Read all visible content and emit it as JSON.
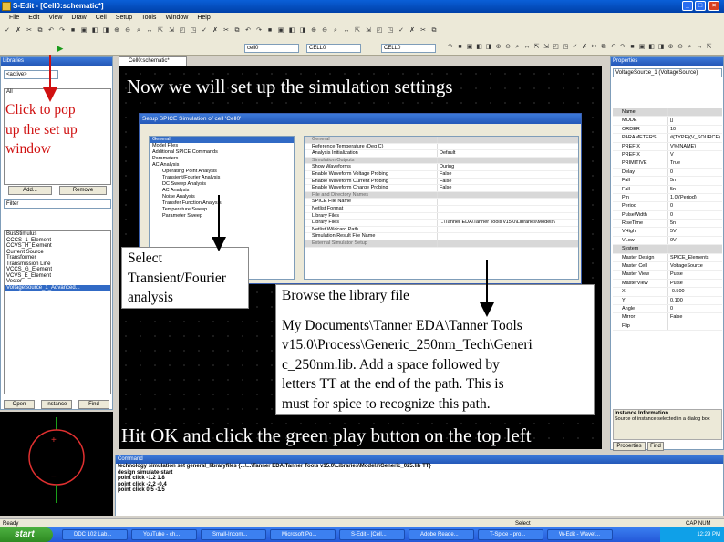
{
  "window": {
    "title": "S-Edit - [Cell0:schematic*]"
  },
  "menu": [
    "File",
    "Edit",
    "View",
    "Draw",
    "Cell",
    "Setup",
    "Tools",
    "Window",
    "Help"
  ],
  "toolbar": {
    "cell_combo": "cell0",
    "combo2": "CELL0",
    "combo3": "CELL0"
  },
  "libraries": {
    "title": "Libraries",
    "selected_lib": "<active>",
    "all_label": "All",
    "add_label": "Add...",
    "remove_label": "Remove",
    "filter_label": "Filter",
    "cells": [
      "BusStimulus",
      "CCCS_1_Element",
      "CCVS_H_Element",
      "Current Source",
      "Transformer",
      "Transmission Line",
      "VCCS_G_Element",
      "VCVS_E_Element",
      "Vector",
      "VoltageSource_1_Advanced..."
    ],
    "open_label": "Open",
    "instance_label": "Instance",
    "find_label": "Find"
  },
  "document_tab": "Cell0:schematic*",
  "headings": {
    "top": "Now we will set up the simulation settings",
    "bottom": "Hit OK and click the green play button on the top left"
  },
  "annotations": {
    "click_to_pop": [
      "Click to pop",
      "up the set up",
      "window"
    ],
    "select_transient": [
      "Select",
      "Transient/Fourier",
      "analysis"
    ],
    "browse": "Browse the library file",
    "path_note": [
      "My Documents\\Tanner EDA\\Tanner Tools",
      "v15.0\\Process\\Generic_250nm_Tech\\Generi",
      "c_250nm.lib. Add a space followed by",
      "letters TT at the end of the path. This is",
      "must for spice to recognize this path."
    ]
  },
  "dialog": {
    "title": "Setup SPICE Simulation of cell 'Cell0'",
    "tree": [
      "General",
      "Model Files",
      "Additional SPICE Commands",
      "Parameters",
      "AC Analysis",
      "Operating Point Analysis",
      "Transient/Fourier Analysis",
      "DC Sweep Analysis",
      "AC Analysis",
      "Noise Analysis",
      "Transfer Function Analysis",
      "Temperature Sweep",
      "Parameter Sweep"
    ],
    "rows": [
      {
        "k": "General",
        "v": "",
        "cat": true
      },
      {
        "k": "Reference Temperature (Deg C)",
        "v": "",
        "cat": false
      },
      {
        "k": "Analysis Initialization",
        "v": "Default",
        "cat": false
      },
      {
        "k": "Simulation Outputs",
        "v": "",
        "cat": true
      },
      {
        "k": "Show Waveforms",
        "v": "During",
        "cat": false
      },
      {
        "k": "Enable Waveform Voltage Probing",
        "v": "False",
        "cat": false
      },
      {
        "k": "Enable Waveform Current Probing",
        "v": "False",
        "cat": false
      },
      {
        "k": "Enable Waveform Charge Probing",
        "v": "False",
        "cat": false
      },
      {
        "k": "File and Directory Names",
        "v": "",
        "cat": true
      },
      {
        "k": "SPICE File Name",
        "v": "",
        "cat": false
      },
      {
        "k": "Netlist Format",
        "v": "",
        "cat": false
      },
      {
        "k": "Library Files",
        "v": "",
        "cat": false
      },
      {
        "k": "Library Files",
        "v": "...\\Tanner EDA\\Tanner Tools v15.0\\Libraries\\Models\\",
        "cat": false
      },
      {
        "k": "Netlist Wildcard Path",
        "v": "",
        "cat": false
      },
      {
        "k": "Simulation Result File Name",
        "v": "",
        "cat": false
      },
      {
        "k": "External Simulator Setup",
        "v": "",
        "cat": true
      }
    ]
  },
  "properties": {
    "title": "Properties",
    "header": "VoltageSource_1 (VoltageSource)",
    "rows": [
      {
        "k": "Name",
        "v": "",
        "cat": true
      },
      {
        "k": "MODE",
        "v": "[]",
        "cat": false
      },
      {
        "k": "ORDER",
        "v": "10",
        "cat": false
      },
      {
        "k": "PARAMETERS",
        "v": "#{TYPE}(V_SOURCE)",
        "cat": false
      },
      {
        "k": "PREFIX",
        "v": "V%{NAME}",
        "cat": false
      },
      {
        "k": "PREFIX",
        "v": "V",
        "cat": false
      },
      {
        "k": "PRIMITIVE",
        "v": "True",
        "cat": false
      },
      {
        "k": "Delay",
        "v": "0",
        "cat": false
      },
      {
        "k": "Fall",
        "v": "5n",
        "cat": false
      },
      {
        "k": "Fall",
        "v": "5n",
        "cat": false
      },
      {
        "k": "Pin",
        "v": "1.0/(Period)",
        "cat": false
      },
      {
        "k": "Period",
        "v": "0",
        "cat": false
      },
      {
        "k": "PulseWidth",
        "v": "0",
        "cat": false
      },
      {
        "k": "RiseTime",
        "v": "5n",
        "cat": false
      },
      {
        "k": "VHigh",
        "v": "5V",
        "cat": false
      },
      {
        "k": "VLow",
        "v": "0V",
        "cat": false
      },
      {
        "k": "System",
        "v": "",
        "cat": true
      },
      {
        "k": "Master Design",
        "v": "SPICE_Elements",
        "cat": false
      },
      {
        "k": "Master Cell",
        "v": "VoltageSource",
        "cat": false
      },
      {
        "k": "Master View",
        "v": "Pulse",
        "cat": false
      },
      {
        "k": "MasterView",
        "v": "Pulse",
        "cat": false
      },
      {
        "k": "X",
        "v": "-0.500",
        "cat": false
      },
      {
        "k": "Y",
        "v": "0.100",
        "cat": false
      },
      {
        "k": "Angle",
        "v": "0",
        "cat": false
      },
      {
        "k": "Mirror",
        "v": "False",
        "cat": false
      },
      {
        "k": "Flip",
        "v": "",
        "cat": false
      }
    ],
    "desc_title": "Instance Information",
    "desc_text": "Source of instance selected in a dialog box",
    "tab1": "Properties",
    "tab2": "Find"
  },
  "command": {
    "title": "Command",
    "lines": [
      "technology simulation set general_libraryfiles {...\\...\\Tanner EDA\\Tanner Tools v15.0\\Libraries\\Models\\Generic_025.lib TT}",
      "design simulate-start",
      "point click -1.2 1.8",
      "point click -2.2 -0.4",
      "point click 0.5 -1.5"
    ]
  },
  "status": {
    "left": "Ready",
    "mid": "Select",
    "right": "CAP NUM"
  },
  "taskbar": {
    "start": "start",
    "tasks": [
      "DDC 102 Lab...",
      "YouTube - ch...",
      "Small-Incom...",
      "Microsoft Po...",
      "S-Edit - [Cell...",
      "Adobe Reade...",
      "T-Spice - pro...",
      "W-Edit - Wavef..."
    ],
    "clock": "12:29 PM"
  }
}
